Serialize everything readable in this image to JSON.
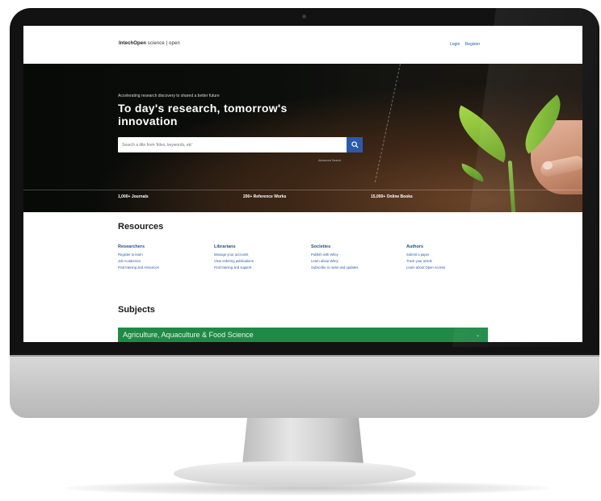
{
  "colors": {
    "bezel": "#121212",
    "brand_blue": "#2b5aa8",
    "subject_green": "#1f8a46",
    "hero_dark": "#0c0e0b"
  },
  "header": {
    "logo_brand": "IntechOpen",
    "logo_suffix": "science | open",
    "login_label": "Login",
    "register_label": "Register"
  },
  "hero": {
    "tagline": "Accelerating  research discovery to  shared a better future",
    "title": "To day's research,  tomorrow's innovation",
    "search_placeholder": "Search a title from 'titles, keywords, etc'",
    "search_icon": "search-icon",
    "advanced_search_label": "Advanced Search",
    "stats": [
      {
        "label": "1,000+ Journals"
      },
      {
        "label": "200+ Reference Works"
      },
      {
        "label": "15,000+ Online Books"
      }
    ]
  },
  "resources": {
    "title": "Resources",
    "columns": [
      {
        "heading": "Researchers",
        "links": [
          "Register to learn",
          "Job Academics",
          "Find training and resources"
        ]
      },
      {
        "heading": "Librarians",
        "links": [
          "Manage your accounts",
          "View ordering publications",
          "Find training and support"
        ]
      },
      {
        "heading": "Societies",
        "links": [
          "Publish with Wiley",
          "Learn about Wiley",
          "Subscribe to news and updates"
        ]
      },
      {
        "heading": "Authors",
        "links": [
          "Submit a paper",
          "Track your article",
          "Learn about Open Access"
        ]
      }
    ]
  },
  "subjects": {
    "title": "Subjects",
    "first_item": "Agriculture, Aquaculture & Food Science",
    "chevron_icon": "chevron-down-icon"
  }
}
